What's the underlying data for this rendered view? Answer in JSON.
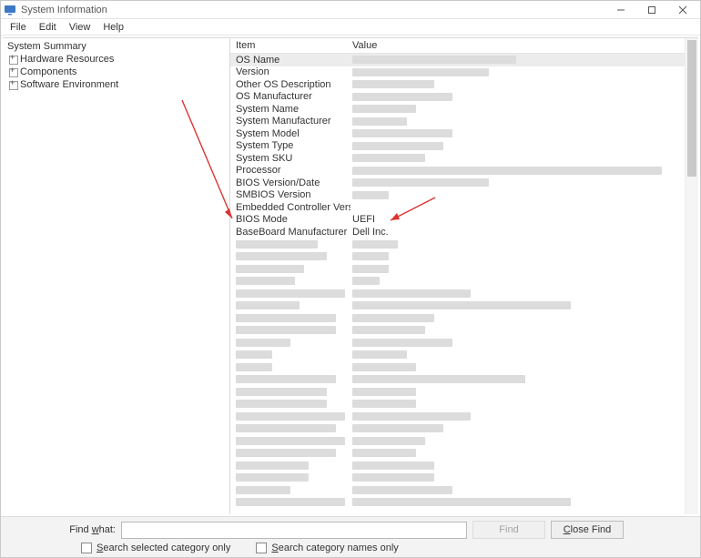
{
  "window": {
    "title": "System Information"
  },
  "menu": {
    "file": "File",
    "edit": "Edit",
    "view": "View",
    "help": "Help"
  },
  "tree": {
    "root": "System Summary",
    "children": [
      "Hardware Resources",
      "Components",
      "Software Environment"
    ]
  },
  "columns": {
    "item": "Item",
    "value": "Value"
  },
  "rows": [
    {
      "item": "OS Name",
      "value": "",
      "selected": true,
      "vblur_w": 180
    },
    {
      "item": "Version",
      "value": "",
      "vblur_w": 150
    },
    {
      "item": "Other OS Description",
      "value": "",
      "vblur_w": 90
    },
    {
      "item": "OS Manufacturer",
      "value": "",
      "vblur_w": 110
    },
    {
      "item": "System Name",
      "value": "",
      "vblur_w": 70
    },
    {
      "item": "System Manufacturer",
      "value": "",
      "vblur_w": 60
    },
    {
      "item": "System Model",
      "value": "",
      "vblur_w": 110
    },
    {
      "item": "System Type",
      "value": "",
      "vblur_w": 100
    },
    {
      "item": "System SKU",
      "value": "",
      "vblur_w": 80
    },
    {
      "item": "Processor",
      "value": "",
      "vblur_w": 340
    },
    {
      "item": "BIOS Version/Date",
      "value": "",
      "vblur_w": 150
    },
    {
      "item": "SMBIOS Version",
      "value": "",
      "vblur_w": 40
    },
    {
      "item": "Embedded Controller Version",
      "value": ""
    },
    {
      "item": "BIOS Mode",
      "value": "UEFI"
    },
    {
      "item": "BaseBoard Manufacturer",
      "value": "Dell Inc."
    },
    {
      "item": "",
      "value": "",
      "iblur_w": 90,
      "vblur_w": 50
    },
    {
      "item": "",
      "value": "",
      "iblur_w": 100,
      "vblur_w": 40
    },
    {
      "item": "",
      "value": "",
      "iblur_w": 75,
      "vblur_w": 40
    },
    {
      "item": "",
      "value": "",
      "iblur_w": 65,
      "vblur_w": 30
    },
    {
      "item": "",
      "value": "",
      "iblur_w": 120,
      "vblur_w": 130
    },
    {
      "item": "",
      "value": "",
      "iblur_w": 70,
      "vblur_w": 240
    },
    {
      "item": "",
      "value": "",
      "iblur_w": 110,
      "vblur_w": 90
    },
    {
      "item": "",
      "value": "",
      "iblur_w": 110,
      "vblur_w": 80
    },
    {
      "item": "",
      "value": "",
      "iblur_w": 60,
      "vblur_w": 110
    },
    {
      "item": "",
      "value": "",
      "iblur_w": 40,
      "vblur_w": 60
    },
    {
      "item": "",
      "value": "",
      "iblur_w": 40,
      "vblur_w": 70
    },
    {
      "item": "",
      "value": "",
      "iblur_w": 110,
      "vblur_w": 190
    },
    {
      "item": "",
      "value": "",
      "iblur_w": 100,
      "vblur_w": 70
    },
    {
      "item": "",
      "value": "",
      "iblur_w": 100,
      "vblur_w": 70
    },
    {
      "item": "",
      "value": "",
      "iblur_w": 120,
      "vblur_w": 130
    },
    {
      "item": "",
      "value": "",
      "iblur_w": 110,
      "vblur_w": 100
    },
    {
      "item": "",
      "value": "",
      "iblur_w": 120,
      "vblur_w": 80
    },
    {
      "item": "",
      "value": "",
      "iblur_w": 110,
      "vblur_w": 70
    },
    {
      "item": "",
      "value": "",
      "iblur_w": 80,
      "vblur_w": 90
    },
    {
      "item": "",
      "value": "",
      "iblur_w": 80,
      "vblur_w": 90
    },
    {
      "item": "",
      "value": "",
      "iblur_w": 60,
      "vblur_w": 110
    },
    {
      "item": "",
      "value": "",
      "iblur_w": 120,
      "vblur_w": 240
    }
  ],
  "find": {
    "label_prefix": "Find ",
    "label_u": "w",
    "label_suffix": "hat:",
    "value": "",
    "find_btn": "Find",
    "close_btn_prefix": "",
    "close_btn_u": "C",
    "close_btn_suffix": "lose Find",
    "chk1_u": "S",
    "chk1_rest": "earch selected category only",
    "chk2_u": "S",
    "chk2_rest": "earch category names only"
  }
}
